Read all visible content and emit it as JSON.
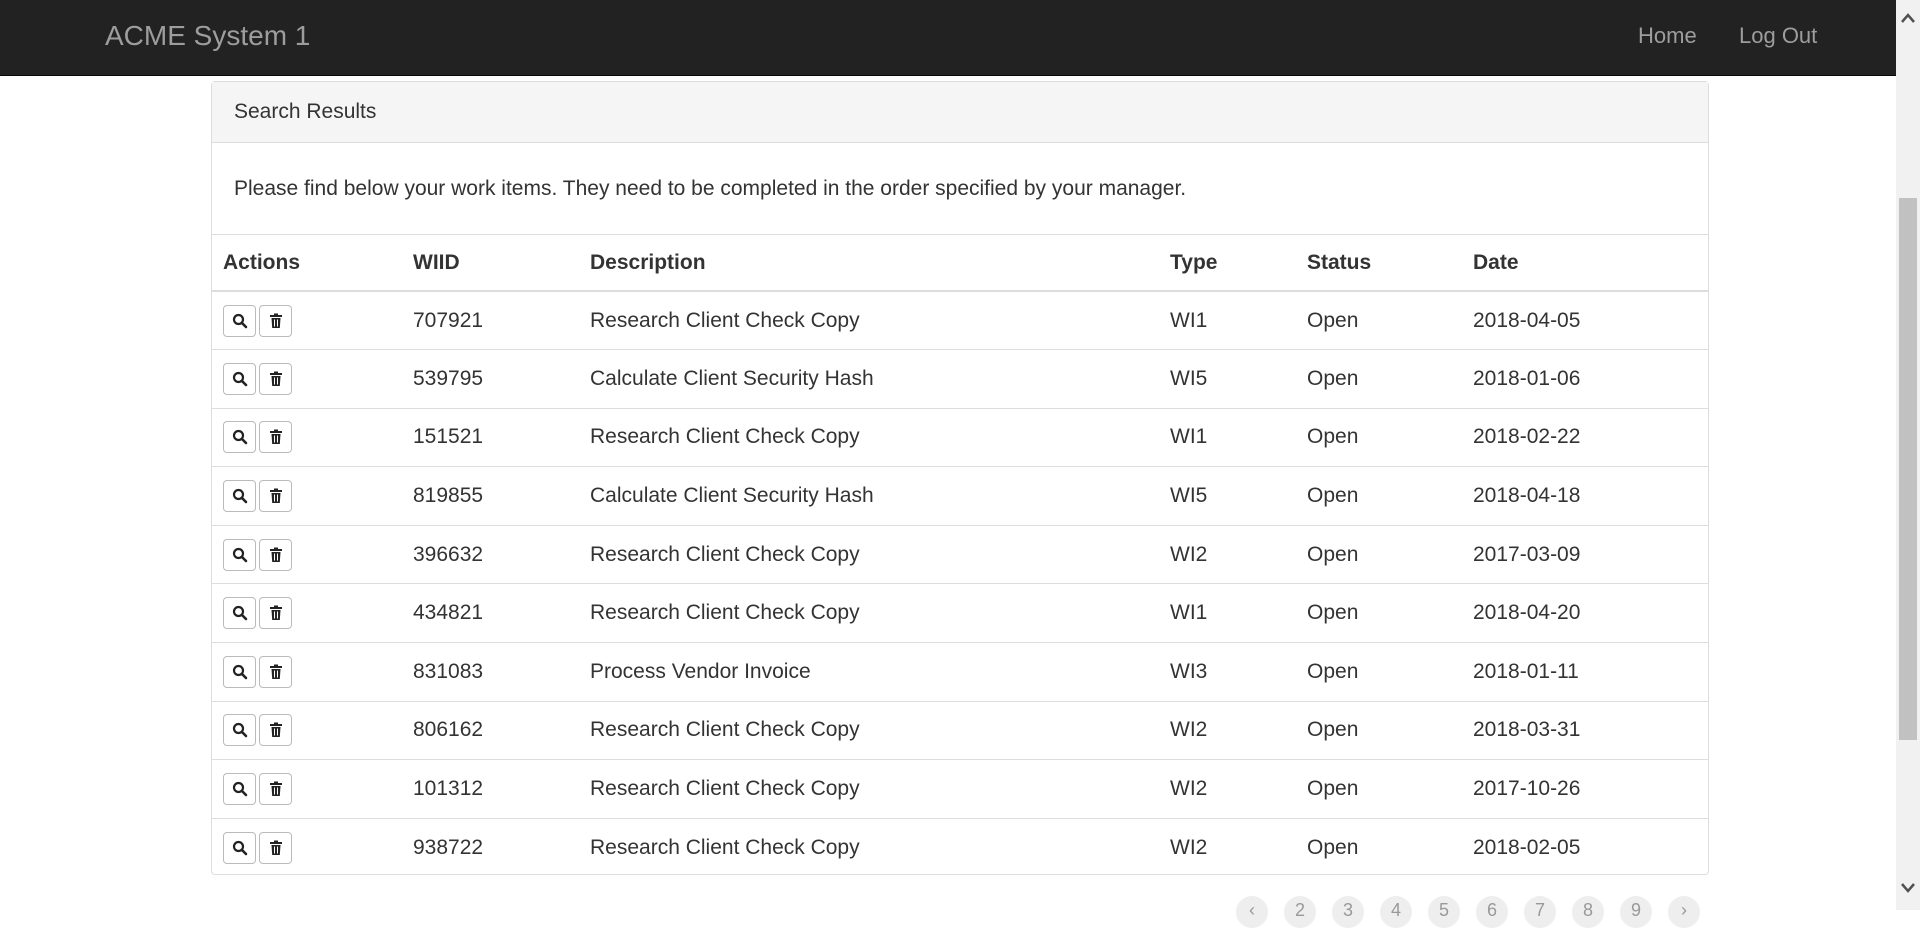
{
  "navbar": {
    "brand": "ACME System 1",
    "home_label": "Home",
    "logout_label": "Log Out"
  },
  "panel": {
    "heading": "Search Results",
    "intro": "Please find below your work items. They need to be completed in the order specified by your manager."
  },
  "table": {
    "headers": [
      "Actions",
      "WIID",
      "Description",
      "Type",
      "Status",
      "Date"
    ],
    "rows": [
      {
        "wiid": "707921",
        "description": "Research Client Check Copy",
        "type": "WI1",
        "status": "Open",
        "date": "2018-04-05"
      },
      {
        "wiid": "539795",
        "description": "Calculate Client Security Hash",
        "type": "WI5",
        "status": "Open",
        "date": "2018-01-06"
      },
      {
        "wiid": "151521",
        "description": "Research Client Check Copy",
        "type": "WI1",
        "status": "Open",
        "date": "2018-02-22"
      },
      {
        "wiid": "819855",
        "description": "Calculate Client Security Hash",
        "type": "WI5",
        "status": "Open",
        "date": "2018-04-18"
      },
      {
        "wiid": "396632",
        "description": "Research Client Check Copy",
        "type": "WI2",
        "status": "Open",
        "date": "2017-03-09"
      },
      {
        "wiid": "434821",
        "description": "Research Client Check Copy",
        "type": "WI1",
        "status": "Open",
        "date": "2018-04-20"
      },
      {
        "wiid": "831083",
        "description": "Process Vendor Invoice",
        "type": "WI3",
        "status": "Open",
        "date": "2018-01-11"
      },
      {
        "wiid": "806162",
        "description": "Research Client Check Copy",
        "type": "WI2",
        "status": "Open",
        "date": "2018-03-31"
      },
      {
        "wiid": "101312",
        "description": "Research Client Check Copy",
        "type": "WI2",
        "status": "Open",
        "date": "2017-10-26"
      },
      {
        "wiid": "938722",
        "description": "Research Client Check Copy",
        "type": "WI2",
        "status": "Open",
        "date": "2018-02-05"
      }
    ]
  },
  "pagination": {
    "items": [
      "‹",
      "2",
      "3",
      "4",
      "5",
      "6",
      "7",
      "8",
      "9",
      "›"
    ]
  },
  "icons": {
    "view": "search-icon",
    "delete": "trash-icon"
  }
}
